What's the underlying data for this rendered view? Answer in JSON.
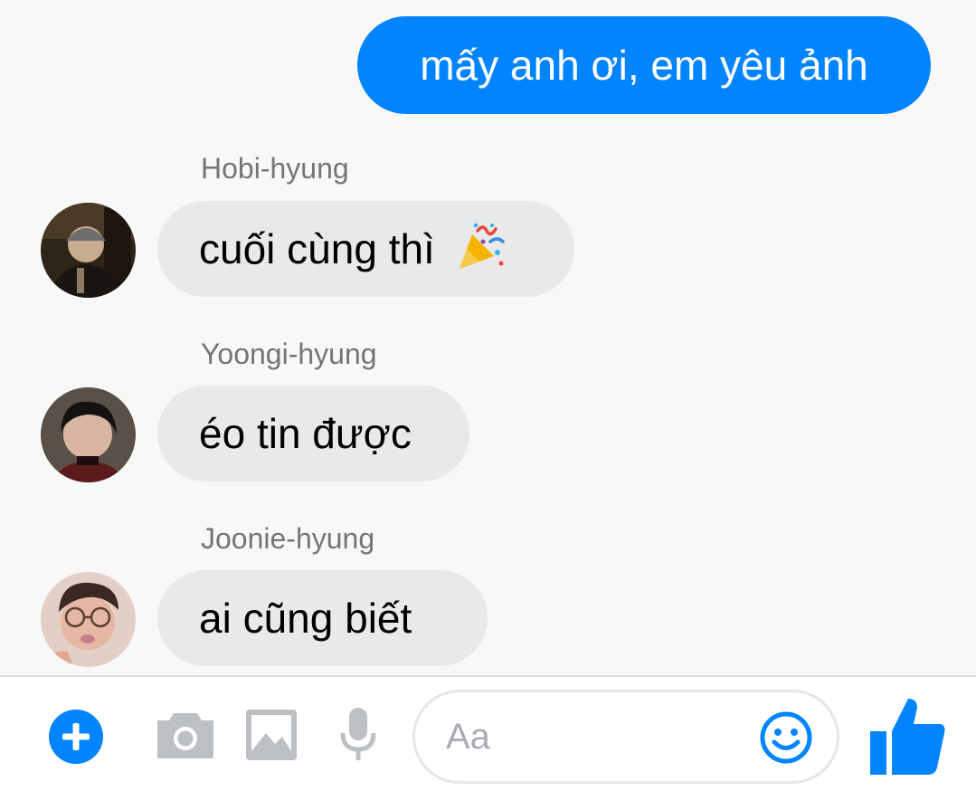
{
  "colors": {
    "accent": "#0084ff",
    "incoming_bubble": "#e9e9e9",
    "background": "#f8f8f8",
    "muted_icon": "#bcc0c4"
  },
  "thread": {
    "outgoing": {
      "text": "mấy anh ơi, em yêu ảnh"
    },
    "incoming": [
      {
        "sender": "Hobi-hyung",
        "text": "cuối cùng thì",
        "emoji": "party-popper-icon"
      },
      {
        "sender": "Yoongi-hyung",
        "text": "éo tin được"
      },
      {
        "sender": "Joonie-hyung",
        "text": "ai cũng biết"
      }
    ]
  },
  "composer": {
    "placeholder": "Aa",
    "icons": [
      "plus-icon",
      "camera-icon",
      "image-icon",
      "microphone-icon",
      "smiley-icon",
      "thumbs-up-icon"
    ]
  }
}
